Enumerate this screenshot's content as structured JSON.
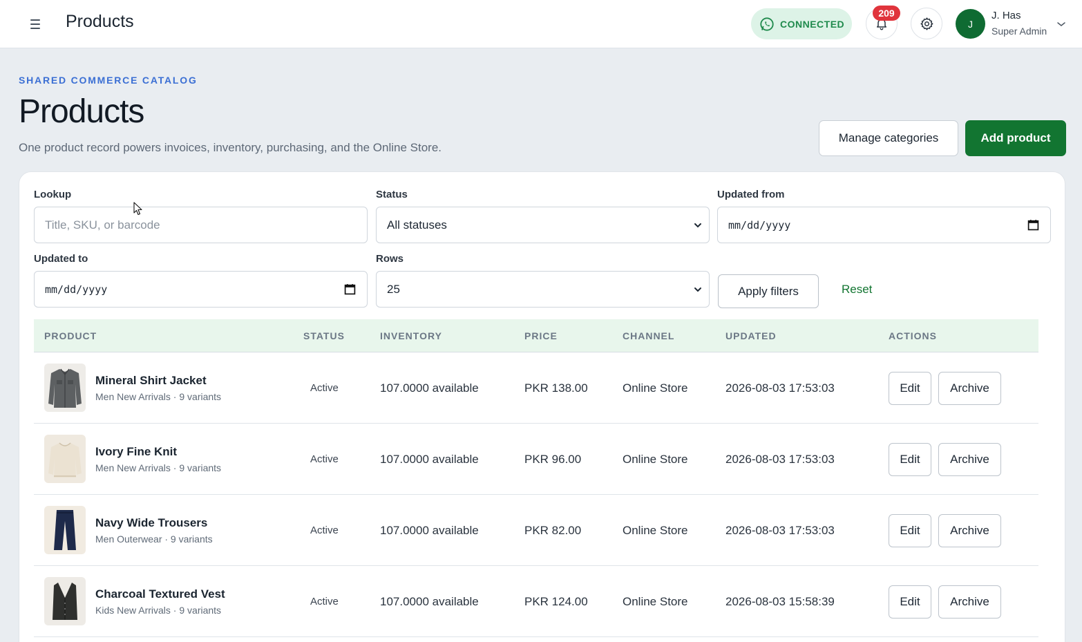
{
  "header": {
    "title": "Products",
    "connection_status": "CONNECTED",
    "notification_count": "209",
    "user": {
      "initial": "J",
      "name": "J. Has",
      "role": "Super Admin"
    }
  },
  "page": {
    "eyebrow": "SHARED COMMERCE CATALOG",
    "title": "Products",
    "subtitle": "One product record powers invoices, inventory, purchasing, and the Online Store.",
    "manage_categories_label": "Manage categories",
    "add_product_label": "Add product"
  },
  "filters": {
    "lookup": {
      "label": "Lookup",
      "placeholder": "Title, SKU, or barcode",
      "value": ""
    },
    "status": {
      "label": "Status",
      "value": "All statuses"
    },
    "updated_from": {
      "label": "Updated from",
      "value": "mm/dd/yyyy"
    },
    "updated_to": {
      "label": "Updated to",
      "value": "mm/dd/yyyy"
    },
    "rows": {
      "label": "Rows",
      "value": "25"
    },
    "apply_label": "Apply filters",
    "reset_label": "Reset"
  },
  "table": {
    "columns": [
      "PRODUCT",
      "STATUS",
      "INVENTORY",
      "PRICE",
      "CHANNEL",
      "UPDATED",
      "ACTIONS"
    ],
    "edit_label": "Edit",
    "archive_label": "Archive",
    "rows": [
      {
        "title": "Mineral Shirt Jacket",
        "meta": "Men New Arrivals · 9 variants",
        "status": "Active",
        "inventory": "107.0000 available",
        "price": "PKR 138.00",
        "channel": "Online Store",
        "updated": "2026-08-03 17:53:03",
        "thumb": "shirt-jacket-image"
      },
      {
        "title": "Ivory Fine Knit",
        "meta": "Men New Arrivals · 9 variants",
        "status": "Active",
        "inventory": "107.0000 available",
        "price": "PKR 96.00",
        "channel": "Online Store",
        "updated": "2026-08-03 17:53:03",
        "thumb": "knit-sweater-image"
      },
      {
        "title": "Navy Wide Trousers",
        "meta": "Men Outerwear · 9 variants",
        "status": "Active",
        "inventory": "107.0000 available",
        "price": "PKR 82.00",
        "channel": "Online Store",
        "updated": "2026-08-03 17:53:03",
        "thumb": "trousers-image"
      },
      {
        "title": "Charcoal Textured Vest",
        "meta": "Kids New Arrivals · 9 variants",
        "status": "Active",
        "inventory": "107.0000 available",
        "price": "PKR 124.00",
        "channel": "Online Store",
        "updated": "2026-08-03 15:58:39",
        "thumb": "vest-image"
      }
    ]
  },
  "colors": {
    "brand_green": "#127531",
    "accent_blue": "#3b6fd4",
    "badge_red": "#e0343c",
    "table_header_bg": "#e8f6ec"
  }
}
